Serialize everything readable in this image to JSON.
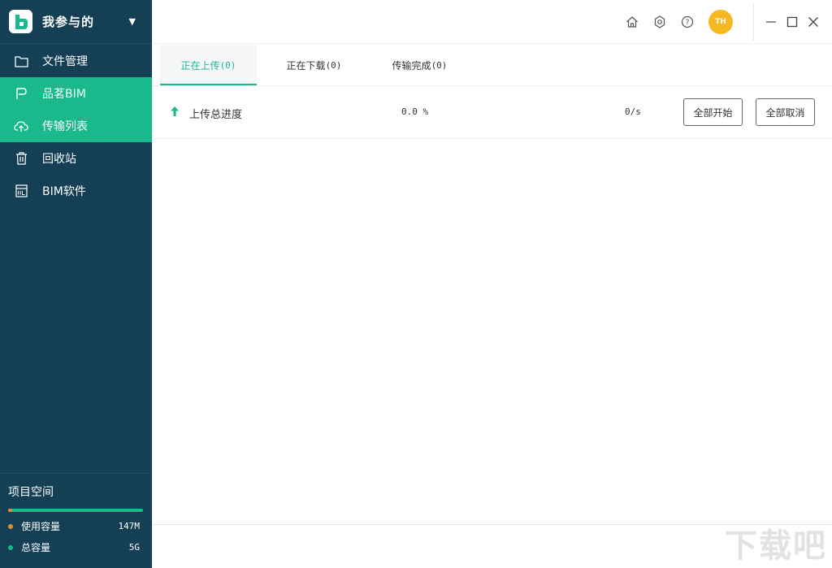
{
  "brand": {
    "title": "我参与的"
  },
  "nav": [
    {
      "label": "文件管理",
      "icon": "folder-icon",
      "active": false
    },
    {
      "label": "品茗BIM",
      "icon": "pinming-icon",
      "active": true
    },
    {
      "label": "传输列表",
      "icon": "cloud-upload-icon",
      "active": true
    },
    {
      "label": "回收站",
      "icon": "trash-icon",
      "active": false
    },
    {
      "label": "BIM软件",
      "icon": "bim-software-icon",
      "active": false
    }
  ],
  "space": {
    "title": "项目空间",
    "used_label": "使用容量",
    "used_value": "147M",
    "total_label": "总容量",
    "total_value": "5G",
    "used_fraction": 0.03,
    "used_color": "#e58a2b",
    "total_color": "#19b98b"
  },
  "header": {
    "avatar_initials": "TH"
  },
  "tabs": [
    {
      "label": "正在上传",
      "count": "(0)",
      "active": true
    },
    {
      "label": "正在下载",
      "count": "(0)",
      "active": false
    },
    {
      "label": "传输完成",
      "count": "(0)",
      "active": false
    }
  ],
  "upload": {
    "label": "上传总进度",
    "percent": "0.0 %",
    "speed": "0/s",
    "start_all": "全部开始",
    "cancel_all": "全部取消"
  },
  "watermark": "下载吧",
  "colors": {
    "sidebar": "#143f55",
    "accent": "#19b98b",
    "avatar": "#f5b820"
  }
}
